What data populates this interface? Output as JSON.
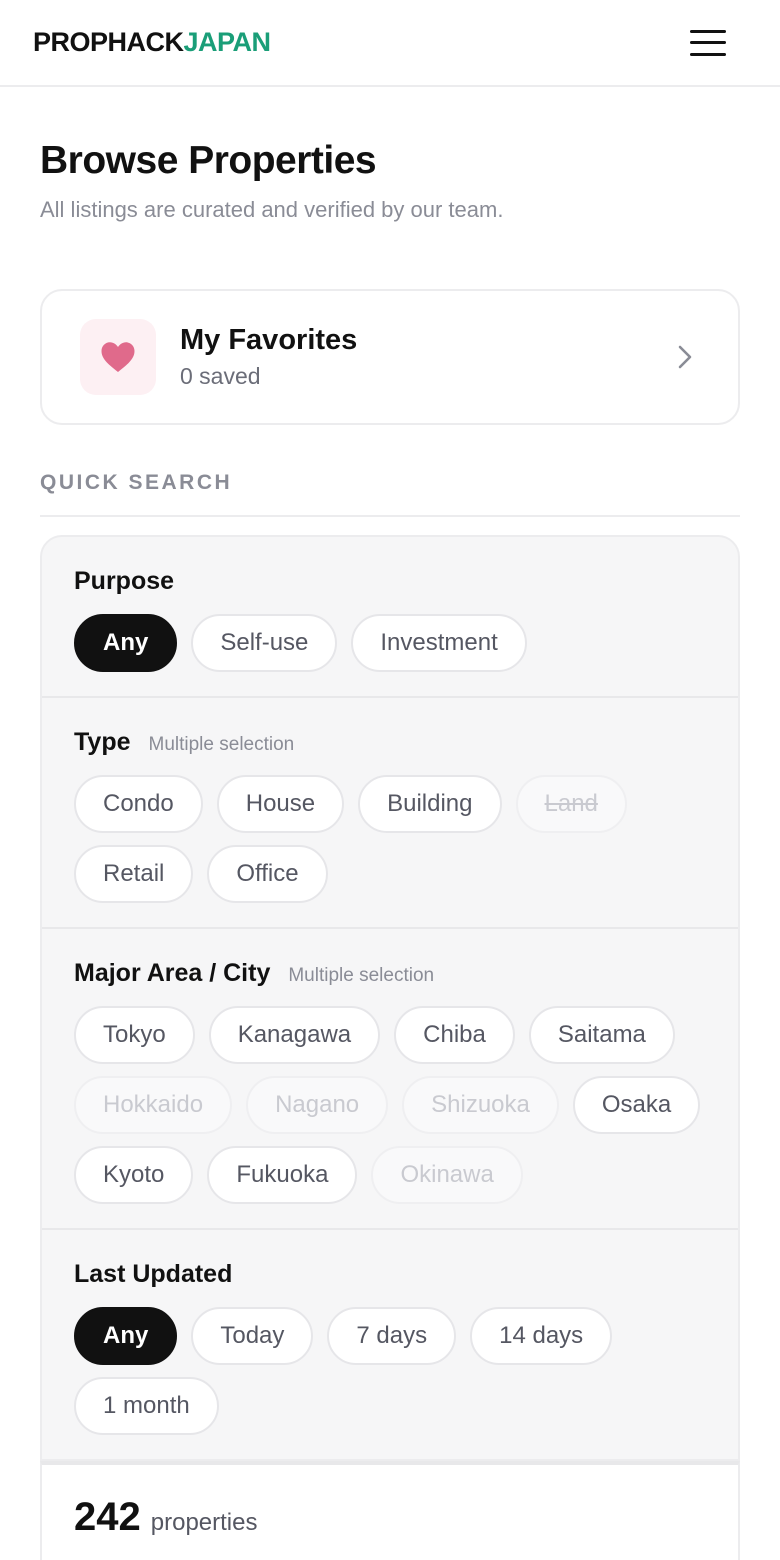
{
  "header": {
    "logo_part1": "PROPHACK",
    "logo_part2": "JAPAN",
    "brand_color": "#1a9e78",
    "menu_icon": "hamburger-menu-icon"
  },
  "page": {
    "title": "Browse Properties",
    "subtitle": "All listings are curated and verified by our team."
  },
  "favorites": {
    "title": "My Favorites",
    "count_text": "0 saved",
    "icon": "heart-icon",
    "icon_color": "#e06a8b"
  },
  "quick_search": {
    "label": "QUICK SEARCH",
    "purpose": {
      "title": "Purpose",
      "options": [
        {
          "label": "Any",
          "state": "active"
        },
        {
          "label": "Self-use",
          "state": "normal"
        },
        {
          "label": "Investment",
          "state": "normal"
        }
      ]
    },
    "type": {
      "title": "Type",
      "hint": "Multiple selection",
      "options": [
        {
          "label": "Condo",
          "state": "normal"
        },
        {
          "label": "House",
          "state": "normal"
        },
        {
          "label": "Building",
          "state": "normal"
        },
        {
          "label": "Land",
          "state": "disabled"
        },
        {
          "label": "Retail",
          "state": "normal"
        },
        {
          "label": "Office",
          "state": "normal"
        }
      ]
    },
    "area": {
      "title": "Major Area / City",
      "hint": "Multiple selection",
      "options": [
        {
          "label": "Tokyo",
          "state": "normal"
        },
        {
          "label": "Kanagawa",
          "state": "normal"
        },
        {
          "label": "Chiba",
          "state": "normal"
        },
        {
          "label": "Saitama",
          "state": "normal"
        },
        {
          "label": "Hokkaido",
          "state": "disabled"
        },
        {
          "label": "Nagano",
          "state": "disabled"
        },
        {
          "label": "Shizuoka",
          "state": "disabled"
        },
        {
          "label": "Osaka",
          "state": "normal"
        },
        {
          "label": "Kyoto",
          "state": "normal"
        },
        {
          "label": "Fukuoka",
          "state": "normal"
        },
        {
          "label": "Okinawa",
          "state": "disabled"
        }
      ]
    },
    "updated": {
      "title": "Last Updated",
      "options": [
        {
          "label": "Any",
          "state": "active"
        },
        {
          "label": "Today",
          "state": "normal"
        },
        {
          "label": "7 days",
          "state": "normal"
        },
        {
          "label": "14 days",
          "state": "normal"
        },
        {
          "label": "1 month",
          "state": "normal"
        }
      ]
    }
  },
  "results": {
    "count": "242",
    "unit": "properties"
  }
}
